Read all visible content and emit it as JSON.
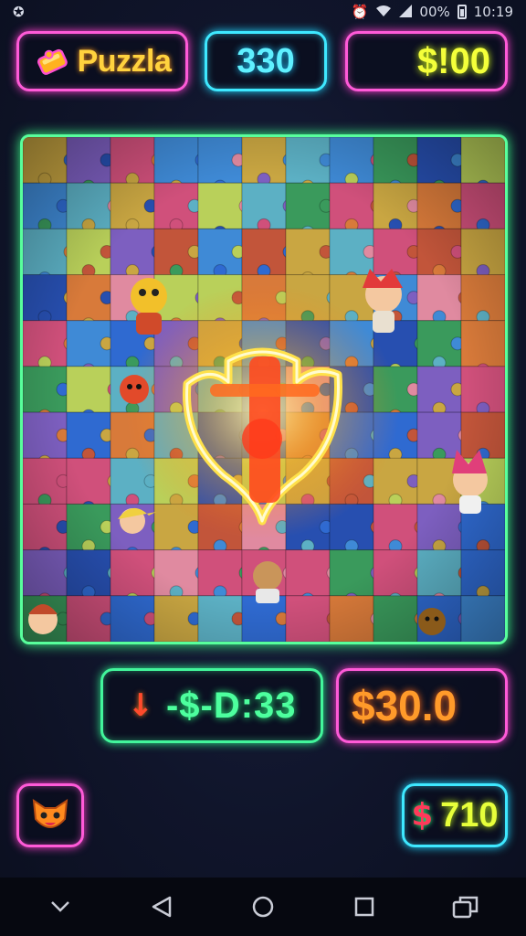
{
  "status": {
    "battery_text": "00%",
    "time": "10:19"
  },
  "header": {
    "title": "Puzzla",
    "score": "330",
    "money": "$!00"
  },
  "board": {
    "colors": [
      "#c2553a",
      "#2f6ad1",
      "#3f8ad6",
      "#d0507b",
      "#3a9a5c",
      "#c9a642",
      "#7d5fc0",
      "#d87a3a",
      "#5cb0c4",
      "#b9d05a",
      "#274fb0",
      "#e08aa0"
    ],
    "accent": "#ffd84a"
  },
  "hud": {
    "timer": "-$-D:33",
    "timer_arrow": "↓",
    "cash": "$30.0",
    "coins_icon": "$",
    "coins": "710"
  },
  "icons": {
    "logo": "puzzle-piece-icon",
    "avatar": "fox-avatar-icon"
  }
}
